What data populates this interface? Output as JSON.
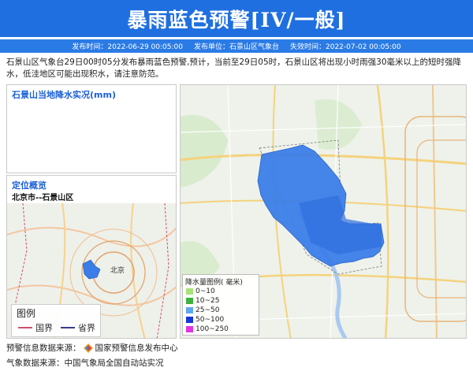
{
  "title": "暴雨蓝色预警[IV/一般]",
  "meta": {
    "publish_time": "发布时间：2022-06-29 00:05:00",
    "publisher": "发布单位：石景山区气象台",
    "expire_time": "失效时间：2022-07-02 00:05:00"
  },
  "description": "石景山区气象台29日00时05分发布暴雨蓝色预警,预计，当前至29日05时，石景山区将出现小时雨强30毫米以上的短时强降水，低洼地区可能出现积水，请注意防范。",
  "rain_panel": {
    "title": "石景山当地降水实况(mm)"
  },
  "location_panel": {
    "title": "定位概览",
    "subtitle": "北京市--石景山区",
    "city_label": "北京"
  },
  "boundary_legend": {
    "title": "图例",
    "items": [
      {
        "label": "国界",
        "color": "#d0506f"
      },
      {
        "label": "省界",
        "color": "#3a3a8a"
      }
    ]
  },
  "rain_legend": {
    "title": "降水量图例( 毫米)",
    "items": [
      {
        "label": "0~10",
        "color": "#a6e37a"
      },
      {
        "label": "10~25",
        "color": "#3db33d"
      },
      {
        "label": "25~50",
        "color": "#5ea8f0"
      },
      {
        "label": "50~100",
        "color": "#1538d6"
      },
      {
        "label": "100~250",
        "color": "#e234e2"
      }
    ]
  },
  "sources": {
    "warning": "预警信息数据来源：",
    "warning_org": "国家预警信息发布中心",
    "weather": "气象数据来源：中国气象局全国自动站实况"
  },
  "colors": {
    "accent": "#1f6fe0",
    "rain_area": "#3b7de8"
  }
}
